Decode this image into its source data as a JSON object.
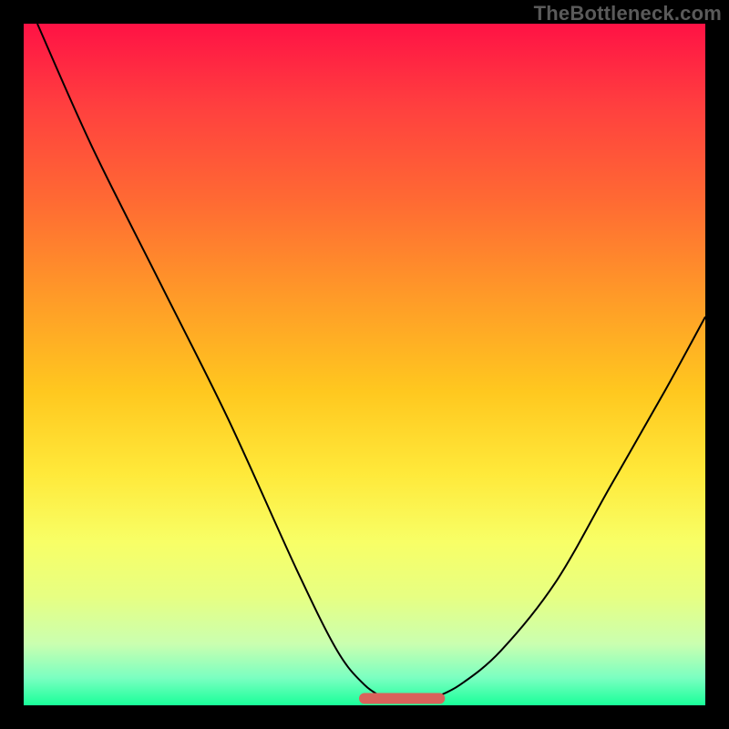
{
  "watermark": "TheBottleneck.com",
  "chart_data": {
    "type": "line",
    "title": "",
    "xlabel": "",
    "ylabel": "",
    "xlim": [
      0,
      100
    ],
    "ylim": [
      0,
      100
    ],
    "series": [
      {
        "name": "left-curve",
        "x": [
          2,
          10,
          20,
          30,
          40,
          46,
          50,
          53
        ],
        "values": [
          100,
          82,
          62,
          42,
          20,
          8,
          3,
          1
        ]
      },
      {
        "name": "right-curve",
        "x": [
          60,
          64,
          70,
          78,
          86,
          94,
          100
        ],
        "values": [
          1,
          3,
          8,
          18,
          32,
          46,
          57
        ]
      },
      {
        "name": "flat-bottom-band",
        "x": [
          50,
          61
        ],
        "values": [
          1,
          1
        ]
      }
    ],
    "grid": false,
    "legend": false,
    "colors": {
      "curve": "#000000",
      "band": "#d9635b",
      "gradient_top": "#ff1245",
      "gradient_bottom": "#19ff99"
    }
  }
}
